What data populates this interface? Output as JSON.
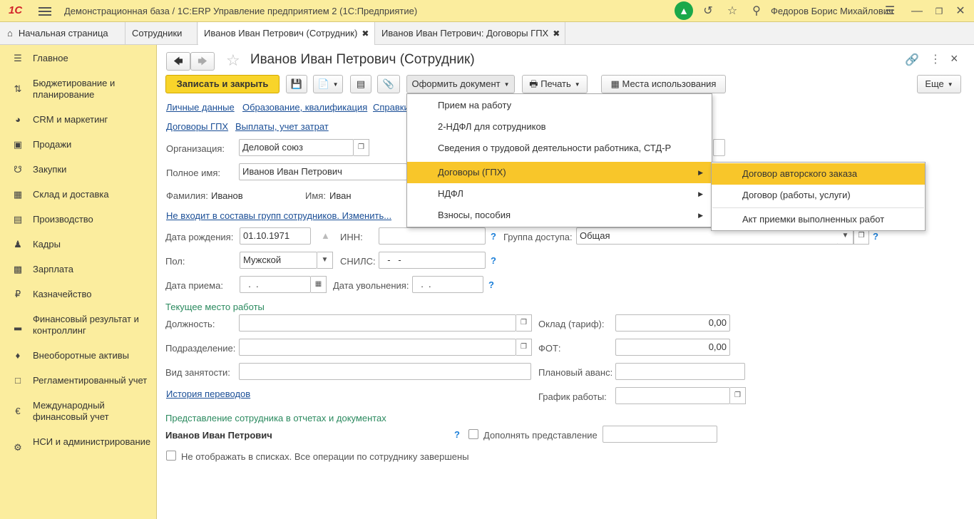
{
  "app": {
    "logo": "1С",
    "title": "Демонстрационная база / 1С:ERP Управление предприятием 2  (1С:Предприятие)",
    "user": "Федоров Борис Михайлович"
  },
  "tabs": [
    {
      "label": "Начальная страница"
    },
    {
      "label": "Сотрудники"
    },
    {
      "label": "Иванов Иван Петрович (Сотрудник)",
      "close": "✖"
    },
    {
      "label": "Иванов Иван Петрович: Договоры ГПХ",
      "close": "✖"
    }
  ],
  "sidebar": {
    "items": [
      {
        "label": "Главное",
        "icon": "menu-icon"
      },
      {
        "label": "Бюджетирование и планирование",
        "icon": "budget-icon"
      },
      {
        "label": "CRM и маркетинг",
        "icon": "pie-icon"
      },
      {
        "label": "Продажи",
        "icon": "bag-icon"
      },
      {
        "label": "Закупки",
        "icon": "cart-icon"
      },
      {
        "label": "Склад и доставка",
        "icon": "warehouse-icon"
      },
      {
        "label": "Производство",
        "icon": "factory-icon"
      },
      {
        "label": "Кадры",
        "icon": "person-icon"
      },
      {
        "label": "Зарплата",
        "icon": "salary-icon"
      },
      {
        "label": "Казначейство",
        "icon": "ruble-icon"
      },
      {
        "label": "Финансовый результат и контроллинг",
        "icon": "chart-icon"
      },
      {
        "label": "Внеоборотные активы",
        "icon": "car-icon"
      },
      {
        "label": "Регламентированный учет",
        "icon": "regulated-icon"
      },
      {
        "label": "Международный финансовый учет",
        "icon": "euro-icon"
      },
      {
        "label": "НСИ и администрирование",
        "icon": "gear-icon"
      }
    ]
  },
  "form": {
    "title": "Иванов Иван Петрович (Сотрудник)",
    "toolbar": {
      "save_close": "Записать и закрыть",
      "make_document": "Оформить документ",
      "print": "Печать",
      "usage": "Места использования",
      "more": "Еще"
    },
    "links_row1": [
      "Личные данные",
      "Образование, квалификация",
      "Справки"
    ],
    "links_row2": [
      "Договоры ГПХ",
      "Выплаты, учет затрат"
    ],
    "organization": {
      "label": "Организация:",
      "value": "Деловой союз"
    },
    "full_name": {
      "label": "Полное имя:",
      "value": "Иванов Иван Петрович"
    },
    "last_name": {
      "label": "Фамилия:",
      "value": "Иванов"
    },
    "first_name": {
      "label": "Имя:",
      "value": "Иван"
    },
    "groups_link": "Не входит в составы групп сотрудников. Изменить...",
    "birth_date": {
      "label": "Дата рождения:",
      "value": "01.10.1971"
    },
    "inn": {
      "label": "ИНН:",
      "value": ""
    },
    "access_group": {
      "label": "Группа доступа:",
      "value": "Общая"
    },
    "gender": {
      "label": "Пол:",
      "value": "Мужской"
    },
    "snils": {
      "label": "СНИЛС:",
      "value": "  -   -"
    },
    "hire_date": {
      "label": "Дата приема:",
      "value": "  .  ."
    },
    "dismissal_date": {
      "label": "Дата увольнения:",
      "value": "  .  ."
    },
    "current_job_section": "Текущее место работы",
    "position": {
      "label": "Должность:",
      "value": ""
    },
    "department": {
      "label": "Подразделение:",
      "value": ""
    },
    "employment_type": {
      "label": "Вид занятости:",
      "value": ""
    },
    "salary": {
      "label": "Оклад (тариф):",
      "value": "0,00"
    },
    "fot": {
      "label": "ФОТ:",
      "value": "0,00"
    },
    "planned_advance": {
      "label": "Плановый аванс:",
      "value": ""
    },
    "schedule": {
      "label": "График работы:",
      "value": ""
    },
    "transfer_history": "История переводов",
    "representation_section": "Представление сотрудника в отчетах и документах",
    "representation_value": "Иванов Иван Петрович",
    "complement_label": "Дополнять представление",
    "complement_value": "",
    "hide_label": "Не отображать в списках. Все операции по сотруднику завершены",
    "help": "?"
  },
  "menu": {
    "items": [
      {
        "label": "Прием на работу"
      },
      {
        "label": "2-НДФЛ для сотрудников"
      },
      {
        "label": "Сведения о трудовой деятельности работника, СТД-Р"
      },
      {
        "label": "Договоры (ГПХ)",
        "submenu": true,
        "highlighted": true
      },
      {
        "label": "НДФЛ",
        "submenu": true
      },
      {
        "label": "Взносы, пособия",
        "submenu": true
      }
    ],
    "submenu": [
      {
        "label": "Договор авторского заказа",
        "highlighted": true
      },
      {
        "label": "Договор (работы, услуги)"
      },
      {
        "label": "Акт приемки выполненных работ"
      }
    ]
  },
  "colors": {
    "sidebar_bg": "#fbed9e",
    "accent": "#f8d42a",
    "highlight": "#f8c62a",
    "link": "#1a4e96",
    "section": "#2b8a5f",
    "help": "#1a7ed8"
  }
}
